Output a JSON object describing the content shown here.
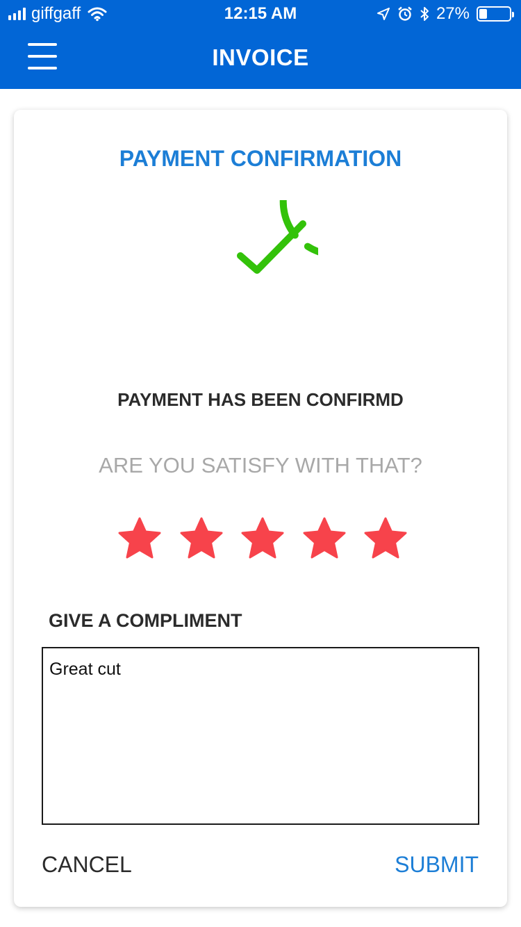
{
  "status_bar": {
    "carrier": "giffgaff",
    "time": "12:15 AM",
    "battery_percent": "27%",
    "battery_level": 0.27,
    "icons": [
      "signal-icon",
      "wifi-icon",
      "location-icon",
      "alarm-icon",
      "bluetooth-icon",
      "battery-icon"
    ]
  },
  "header": {
    "title": "INVOICE",
    "menu_icon": "hamburger-menu-icon"
  },
  "card": {
    "title": "PAYMENT CONFIRMATION",
    "status_icon": "check-circle-icon",
    "confirm_message": "PAYMENT HAS BEEN CONFIRMD",
    "question": "ARE YOU SATISFY WITH THAT?",
    "rating": {
      "value": 5,
      "max": 5
    },
    "compliment_label": "GIVE A COMPLIMENT",
    "compliment_value": "Great cut",
    "cancel_label": "CANCEL",
    "submit_label": "SUBMIT"
  },
  "colors": {
    "header_bg": "#0266d6",
    "accent": "#1c7ed6",
    "success": "#33c20a",
    "star": "#f7434b",
    "muted_text": "#a8a8a8"
  }
}
